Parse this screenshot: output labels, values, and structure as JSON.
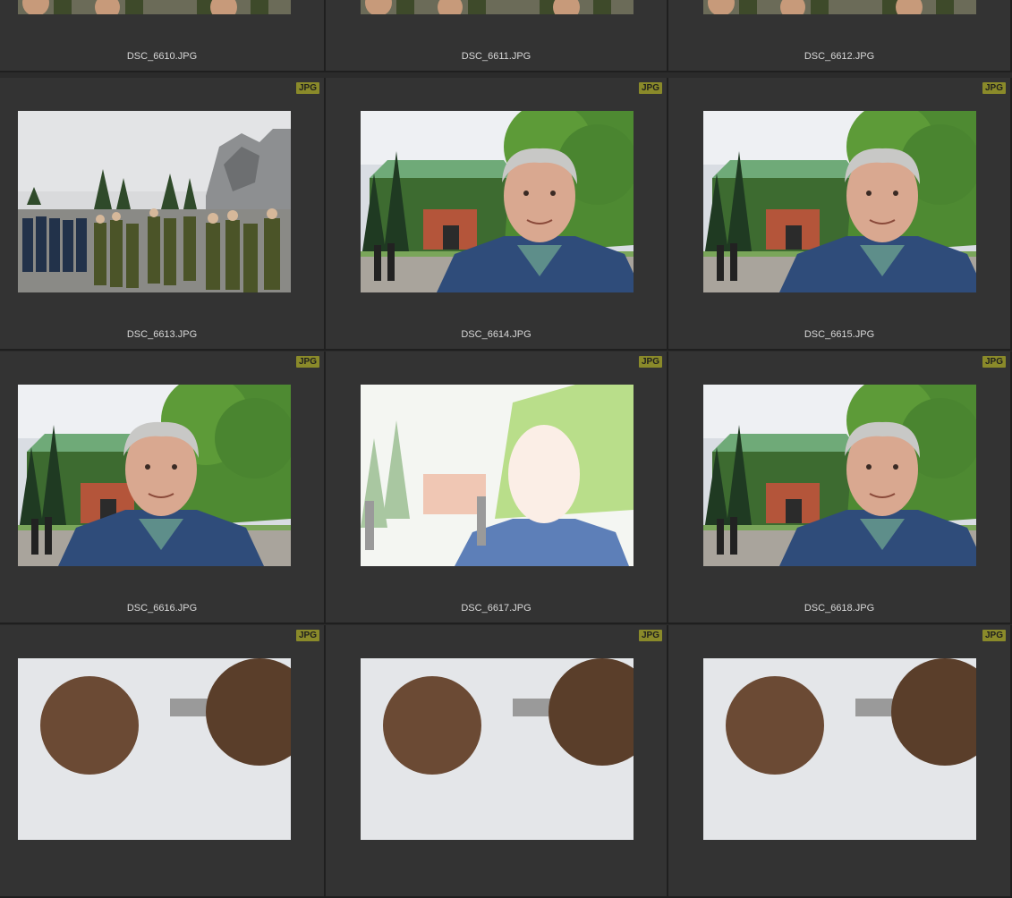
{
  "grid": {
    "cells": [
      {
        "filename": "DSC_6610.JPG",
        "badge": "",
        "scene": "crowd-top"
      },
      {
        "filename": "DSC_6611.JPG",
        "badge": "",
        "scene": "crowd-top"
      },
      {
        "filename": "DSC_6612.JPG",
        "badge": "",
        "scene": "crowd-top"
      },
      {
        "filename": "DSC_6613.JPG",
        "badge": "JPG",
        "scene": "parade"
      },
      {
        "filename": "DSC_6614.JPG",
        "badge": "JPG",
        "scene": "portrait"
      },
      {
        "filename": "DSC_6615.JPG",
        "badge": "JPG",
        "scene": "portrait"
      },
      {
        "filename": "DSC_6616.JPG",
        "badge": "JPG",
        "scene": "portrait-left"
      },
      {
        "filename": "DSC_6617.JPG",
        "badge": "JPG",
        "scene": "overexposed"
      },
      {
        "filename": "DSC_6618.JPG",
        "badge": "JPG",
        "scene": "portrait"
      },
      {
        "filename": "",
        "badge": "JPG",
        "scene": "heads"
      },
      {
        "filename": "",
        "badge": "JPG",
        "scene": "heads"
      },
      {
        "filename": "",
        "badge": "JPG",
        "scene": "heads"
      }
    ]
  },
  "colors": {
    "badge_bg": "#8a8a2a",
    "cell_bg": "#333333",
    "separator": "#1f1f1f",
    "filename_text": "#d8d8d8"
  }
}
